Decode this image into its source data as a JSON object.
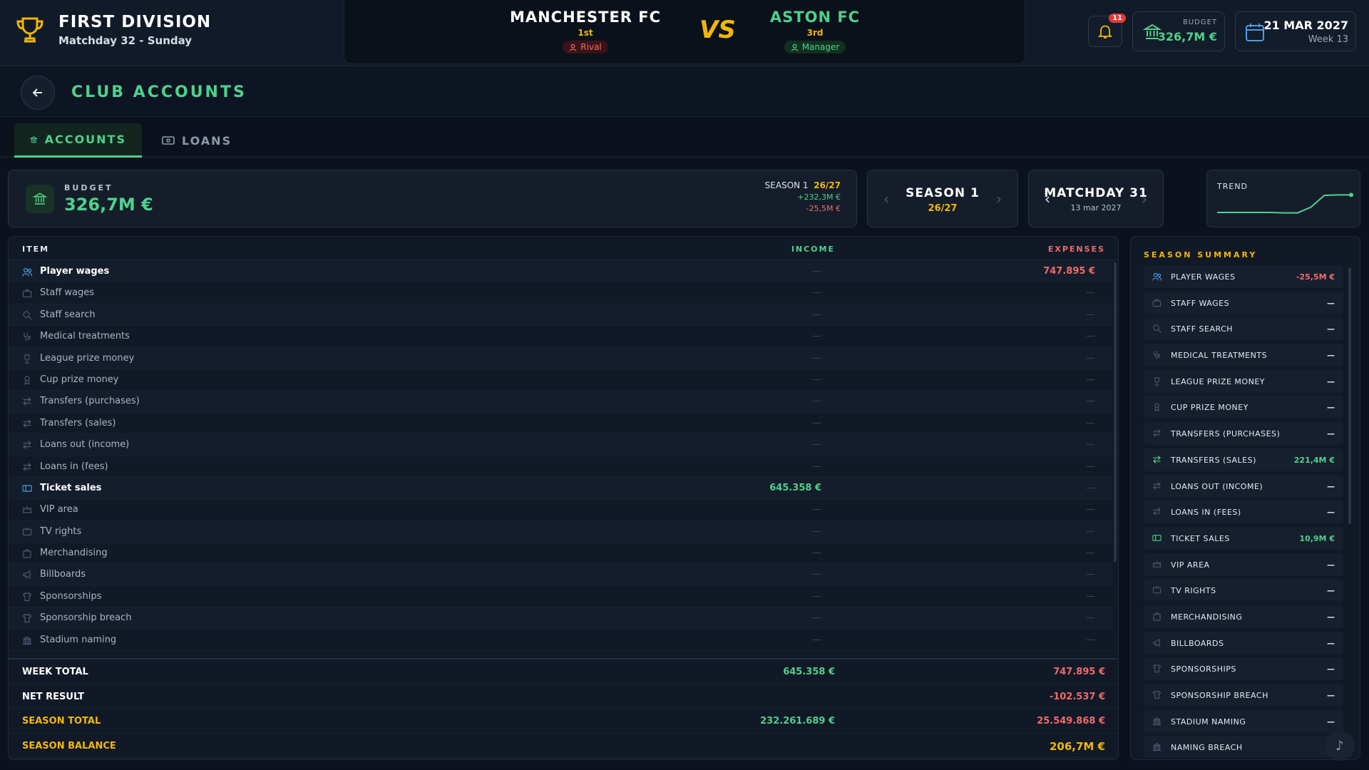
{
  "header": {
    "league_title": "FIRST DIVISION",
    "league_sub": "Matchday 32 - Sunday",
    "home": {
      "name": "MANCHESTER FC",
      "position": "1st",
      "tag": "Rival"
    },
    "vs": "VS",
    "away": {
      "name": "ASTON FC",
      "position": "3rd",
      "tag": "Manager"
    },
    "notifications": "11",
    "budget_label": "BUDGET",
    "budget_value": "326,7M €",
    "date": "21 MAR 2027",
    "week": "Week 13"
  },
  "page": {
    "title": "CLUB ACCOUNTS"
  },
  "tabs": [
    {
      "label": "ACCOUNTS",
      "icon": "bank-icon"
    },
    {
      "label": "LOANS",
      "icon": "cash-icon"
    }
  ],
  "budget_card": {
    "label": "BUDGET",
    "value": "326,7M €",
    "season_label": "SEASON 1",
    "season_year": "26/27",
    "plus": "+232,3M €",
    "minus": "-25,5M €"
  },
  "season_nav": {
    "title": "SEASON 1",
    "sub": "26/27"
  },
  "matchday_nav": {
    "title": "MATCHDAY 31",
    "sub": "13 mar 2027"
  },
  "trend": {
    "label": "TREND",
    "values": [
      0.1,
      0.1,
      0.1,
      0.1,
      0.1,
      0.08,
      0.08,
      0.35,
      0.9,
      0.92,
      0.92
    ]
  },
  "table": {
    "col_item": "ITEM",
    "col_income": "INCOME",
    "col_expenses": "EXPENSES",
    "rows": [
      {
        "label": "Player wages",
        "icon": "users-icon",
        "income": "—",
        "expenses": "747.895 €",
        "highlight": true
      },
      {
        "label": "Staff wages",
        "icon": "briefcase-icon",
        "income": "—",
        "expenses": "—"
      },
      {
        "label": "Staff search",
        "icon": "search-icon",
        "income": "—",
        "expenses": "—"
      },
      {
        "label": "Medical treatments",
        "icon": "stethoscope-icon",
        "income": "—",
        "expenses": "—"
      },
      {
        "label": "League prize money",
        "icon": "trophy-icon",
        "income": "—",
        "expenses": "—"
      },
      {
        "label": "Cup prize money",
        "icon": "medal-icon",
        "income": "—",
        "expenses": "—"
      },
      {
        "label": "Transfers (purchases)",
        "icon": "arrows-icon",
        "income": "—",
        "expenses": "—"
      },
      {
        "label": "Transfers (sales)",
        "icon": "arrows-icon",
        "income": "—",
        "expenses": "—"
      },
      {
        "label": "Loans out (income)",
        "icon": "arrows-icon",
        "income": "—",
        "expenses": "—"
      },
      {
        "label": "Loans in (fees)",
        "icon": "arrows-icon",
        "income": "—",
        "expenses": "—"
      },
      {
        "label": "Ticket sales",
        "icon": "ticket-icon",
        "income": "645.358 €",
        "expenses": "—",
        "highlight": true
      },
      {
        "label": "VIP area",
        "icon": "crown-icon",
        "income": "—",
        "expenses": "—"
      },
      {
        "label": "TV rights",
        "icon": "tv-icon",
        "income": "—",
        "expenses": "—"
      },
      {
        "label": "Merchandising",
        "icon": "bag-icon",
        "income": "—",
        "expenses": "—"
      },
      {
        "label": "Billboards",
        "icon": "megaphone-icon",
        "income": "—",
        "expenses": "—"
      },
      {
        "label": "Sponsorships",
        "icon": "shirt-icon",
        "income": "—",
        "expenses": "—"
      },
      {
        "label": "Sponsorship breach",
        "icon": "shirt-icon",
        "income": "—",
        "expenses": "—"
      },
      {
        "label": "Stadium naming",
        "icon": "stadium-icon",
        "income": "—",
        "expenses": "—"
      }
    ],
    "footer": [
      {
        "label": "WEEK TOTAL",
        "income": "645.358 €",
        "expenses": "747.895 €"
      },
      {
        "label": "NET RESULT",
        "income": "",
        "expenses": "-102.537 €"
      },
      {
        "label": "SEASON TOTAL",
        "income": "232.261.689 €",
        "expenses": "25.549.868 €"
      },
      {
        "label": "SEASON BALANCE",
        "income": "",
        "expenses": "206,7M €"
      }
    ]
  },
  "summary": {
    "title": "SEASON SUMMARY",
    "items": [
      {
        "label": "PLAYER WAGES",
        "icon": "users-icon",
        "value": "-25,5M €",
        "tone": "neg"
      },
      {
        "label": "STAFF WAGES",
        "icon": "briefcase-icon",
        "value": "—"
      },
      {
        "label": "STAFF SEARCH",
        "icon": "search-icon",
        "value": "—"
      },
      {
        "label": "MEDICAL TREATMENTS",
        "icon": "stethoscope-icon",
        "value": "—"
      },
      {
        "label": "LEAGUE PRIZE MONEY",
        "icon": "trophy-icon",
        "value": "—"
      },
      {
        "label": "CUP PRIZE MONEY",
        "icon": "medal-icon",
        "value": "—"
      },
      {
        "label": "TRANSFERS (PURCHASES)",
        "icon": "arrows-icon",
        "value": "—"
      },
      {
        "label": "TRANSFERS (SALES)",
        "icon": "arrows-icon",
        "value": "221,4M €",
        "tone": "pos"
      },
      {
        "label": "LOANS OUT (INCOME)",
        "icon": "arrows-icon",
        "value": "—"
      },
      {
        "label": "LOANS IN (FEES)",
        "icon": "arrows-icon",
        "value": "—"
      },
      {
        "label": "TICKET SALES",
        "icon": "ticket-icon",
        "value": "10,9M €",
        "tone": "pos"
      },
      {
        "label": "VIP AREA",
        "icon": "crown-icon",
        "value": "—"
      },
      {
        "label": "TV RIGHTS",
        "icon": "tv-icon",
        "value": "—"
      },
      {
        "label": "MERCHANDISING",
        "icon": "bag-icon",
        "value": "—"
      },
      {
        "label": "BILLBOARDS",
        "icon": "megaphone-icon",
        "value": "—"
      },
      {
        "label": "SPONSORSHIPS",
        "icon": "shirt-icon",
        "value": "—"
      },
      {
        "label": "SPONSORSHIP BREACH",
        "icon": "shirt-icon",
        "value": "—"
      },
      {
        "label": "STADIUM NAMING",
        "icon": "stadium-icon",
        "value": "—"
      },
      {
        "label": "NAMING BREACH",
        "icon": "stadium-icon",
        "value": "—"
      }
    ]
  },
  "colors": {
    "accent": "#4fd18b",
    "gold": "#f2b705",
    "negative": "#f06b6b",
    "background": "#0c121d"
  }
}
